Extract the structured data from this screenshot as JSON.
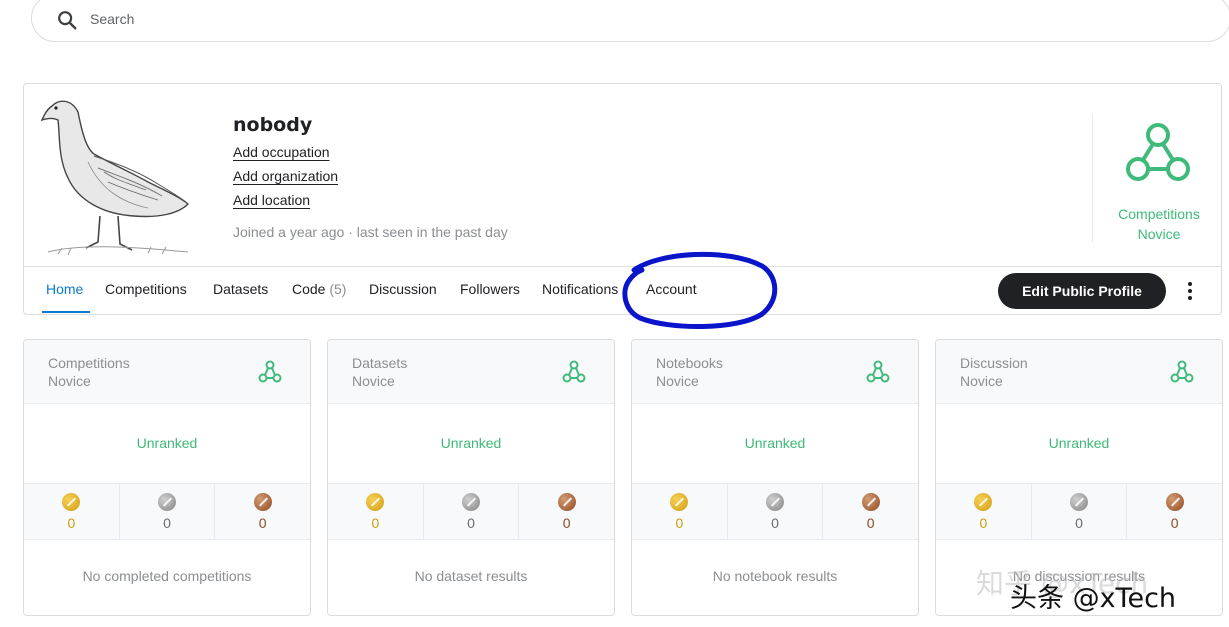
{
  "search": {
    "placeholder": "Search"
  },
  "profile": {
    "name": "nobody",
    "links": [
      "Add occupation",
      "Add organization",
      "Add location"
    ],
    "joined": "Joined a year ago · last seen in the past day",
    "tier": {
      "line1": "Competitions",
      "line2": "Novice"
    }
  },
  "tabs": [
    {
      "label": "Home",
      "count": ""
    },
    {
      "label": "Competitions",
      "count": ""
    },
    {
      "label": "Datasets",
      "count": ""
    },
    {
      "label": "Code",
      "count": "(5)"
    },
    {
      "label": "Discussion",
      "count": ""
    },
    {
      "label": "Followers",
      "count": ""
    },
    {
      "label": "Notifications",
      "count": ""
    },
    {
      "label": "Account",
      "count": ""
    }
  ],
  "edit_button": "Edit Public Profile",
  "cards": [
    {
      "title1": "Competitions",
      "title2": "Novice",
      "rank": "Unranked",
      "gold": "0",
      "silver": "0",
      "bronze": "0",
      "empty": "No completed competitions"
    },
    {
      "title1": "Datasets",
      "title2": "Novice",
      "rank": "Unranked",
      "gold": "0",
      "silver": "0",
      "bronze": "0",
      "empty": "No dataset results"
    },
    {
      "title1": "Notebooks",
      "title2": "Novice",
      "rank": "Unranked",
      "gold": "0",
      "silver": "0",
      "bronze": "0",
      "empty": "No notebook results"
    },
    {
      "title1": "Discussion",
      "title2": "Novice",
      "rank": "Unranked",
      "gold": "0",
      "silver": "0",
      "bronze": "0",
      "empty": "No discussion results"
    }
  ],
  "colors": {
    "accent": "#0b79d0",
    "tier": "#3fba7a",
    "annotation": "#0a14c8",
    "button": "#202124"
  },
  "watermark": {
    "faint": "知乎 @xTech",
    "bold": "头条 @xTech"
  }
}
